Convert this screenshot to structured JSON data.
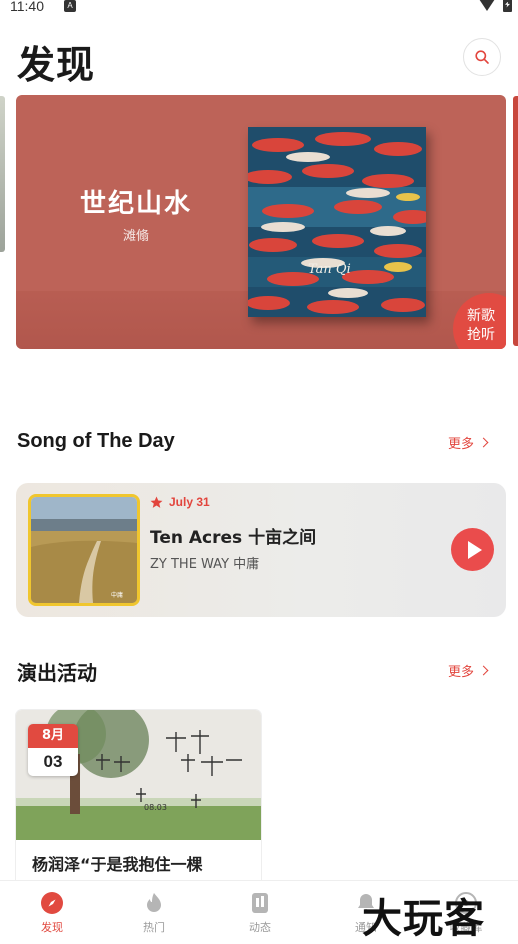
{
  "status_bar": {
    "time": "11:40",
    "notification_badge": "A",
    "icons": [
      "wifi-icon",
      "battery-icon"
    ]
  },
  "header": {
    "title": "发现",
    "search_icon": "search-icon"
  },
  "banner": {
    "title": "世纪山水",
    "artist": "滩翛",
    "album_cover_text": "Tan Qi",
    "badge": "新歌抢听",
    "colors": {
      "background": "#bd6358",
      "badge": "#e14b42"
    }
  },
  "song_of_the_day": {
    "section_title": "Song of The Day",
    "more_label": "更多",
    "date": "July 31",
    "title": "Ten Acres 十亩之间",
    "artist": "ZY THE WAY 中庸",
    "date_icon": "star-icon",
    "play_icon": "play-icon"
  },
  "events": {
    "section_title": "演出活动",
    "more_label": "更多",
    "items": [
      {
        "month": "8月",
        "day": "03",
        "title": "杨润泽“于是我抱住一棵"
      }
    ]
  },
  "tab_bar": {
    "tabs": [
      {
        "label": "发现",
        "icon": "compass-icon",
        "active": true
      },
      {
        "label": "热门",
        "icon": "flame-icon",
        "active": false
      },
      {
        "label": "动态",
        "icon": "feed-icon",
        "active": false
      },
      {
        "label": "通知",
        "icon": "bell-icon",
        "active": false
      },
      {
        "label": "收藏库",
        "icon": "library-icon",
        "active": false
      }
    ]
  },
  "watermark": "大玩客",
  "colors": {
    "accent": "#e2453d",
    "song_cover_border": "#f0c62e"
  }
}
